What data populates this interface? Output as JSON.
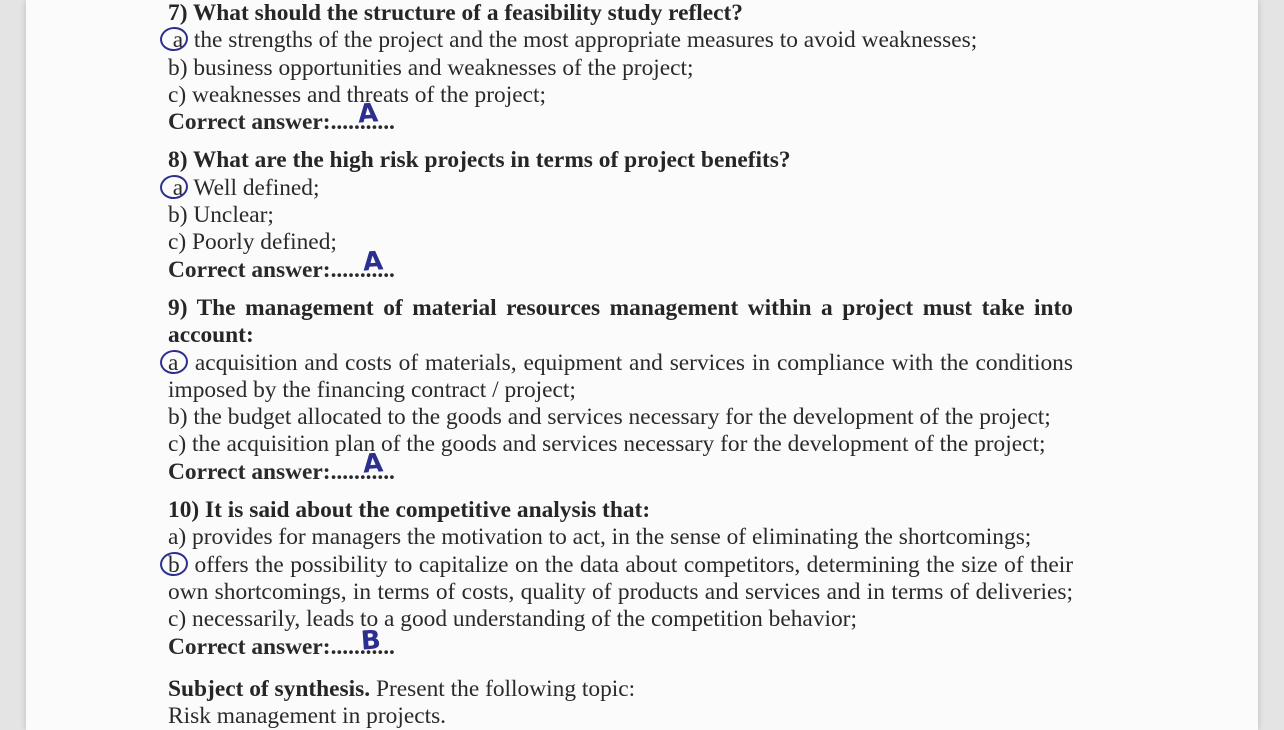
{
  "questions": [
    {
      "title": "7) What should the structure of a feasibility study reflect?",
      "options": [
        {
          "letter": "a",
          "text": " the strengths of the project and the most appropriate measures to avoid weaknesses;"
        },
        {
          "letter": "b)",
          "text": " business opportunities and weaknesses of the project;"
        },
        {
          "letter": "c)",
          "text": " weaknesses and threats of the project;"
        }
      ],
      "answer_label": "Correct answer:...........",
      "handwritten": "A"
    },
    {
      "title": "8) What are the high risk projects in terms of project benefits?",
      "options": [
        {
          "letter": "a",
          "text": " Well defined;"
        },
        {
          "letter": "b)",
          "text": " Unclear;"
        },
        {
          "letter": "c)",
          "text": " Poorly defined;"
        }
      ],
      "answer_label": "Correct answer:...........",
      "handwritten": "A"
    },
    {
      "title_line1": "9) The management of material resources management within a project must take into",
      "title_line2": "account:",
      "options": [
        {
          "letter": "a",
          "text_line1": " acquisition and costs of materials, equipment and services in compliance with the conditions",
          "text_line2": "imposed by the financing contract / project;"
        },
        {
          "letter": "b)",
          "text": " the budget allocated to the goods and services necessary for the development of the project;"
        },
        {
          "letter": "c)",
          "text": " the acquisition plan of the goods and services necessary for the development of the project;"
        }
      ],
      "answer_label": "Correct answer:...........",
      "handwritten": "A"
    },
    {
      "title": "10) It is said about the competitive analysis that:",
      "options": [
        {
          "letter": "a)",
          "text": " provides for managers the motivation to act, in the sense of eliminating the shortcomings;"
        },
        {
          "letter": "b",
          "text_line1": " offers the possibility to capitalize on the data about competitors, determining the size of their",
          "text_line2": "own shortcomings, in terms of costs, quality of products and services and in terms of deliveries;"
        },
        {
          "letter": "c)",
          "text": " necessarily, leads to a good understanding of the competition behavior;"
        }
      ],
      "answer_label": "Correct answer:...........",
      "handwritten": "B"
    }
  ],
  "synthesis": {
    "label": "Subject of synthesis.",
    "text": " Present the following topic:",
    "topic": "Risk management in projects."
  },
  "colors": {
    "ink": "#2d2f8f",
    "paper": "#fbfbfb",
    "text": "#2a2a2a"
  }
}
